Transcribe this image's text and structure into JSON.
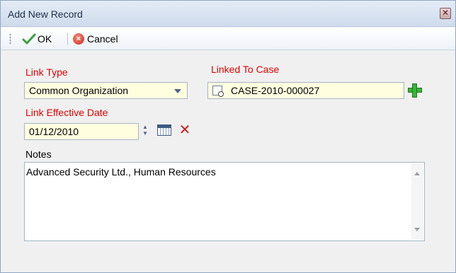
{
  "window": {
    "title": "Add New Record",
    "close_glyph": "✕"
  },
  "toolbar": {
    "ok_label": "OK",
    "cancel_label": "Cancel"
  },
  "form": {
    "link_type": {
      "label": "Link Type",
      "value": "Common Organization"
    },
    "linked_to_case": {
      "label": "Linked To Case",
      "value": "CASE-2010-000027"
    },
    "link_effective_date": {
      "label": "Link Effective Date",
      "value": "01/12/2010"
    },
    "notes": {
      "label": "Notes",
      "value": "Advanced Security Ltd., Human Resources"
    }
  },
  "colors": {
    "required_label": "#e30000",
    "field_background": "#ffffe0",
    "accent_green": "#39b23a",
    "clear_red": "#d21c1c"
  },
  "icons": {
    "ok": "check-icon",
    "cancel": "cancel-icon",
    "case_lookup": "case-lookup-icon",
    "add": "plus-icon",
    "calendar": "calendar-icon",
    "clear": "clear-icon"
  }
}
